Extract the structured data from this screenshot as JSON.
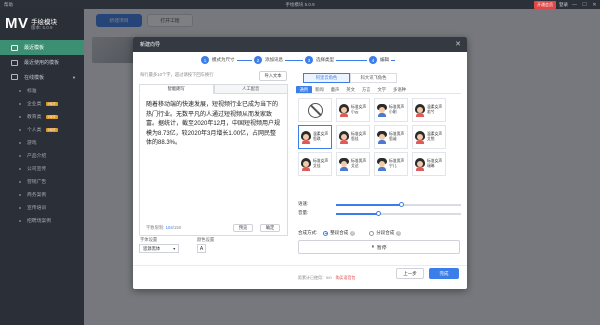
{
  "titlebar": {
    "help": "帮助",
    "title": "手绘模块 5.0.9",
    "vip": "开通会员",
    "login": "登录",
    "minimize": "—",
    "maximize": "☐",
    "close": "✕"
  },
  "brand": {
    "logo": "MV",
    "name": "手绘模块",
    "version": "版本: 5.0.9"
  },
  "sidebar": {
    "recent": "最近模板",
    "recent_used": "最近使用的模板",
    "online": "在线模板",
    "items": [
      {
        "label": "标准",
        "hot": ""
      },
      {
        "label": "企业类",
        "hot": "HOT"
      },
      {
        "label": "教育类",
        "hot": "HOT"
      },
      {
        "label": "个人类",
        "hot": "HOT"
      },
      {
        "label": "游戏",
        "hot": ""
      },
      {
        "label": "产品介绍",
        "hot": ""
      },
      {
        "label": "公司宣传",
        "hot": ""
      },
      {
        "label": "营销广告",
        "hot": ""
      },
      {
        "label": "商务案例",
        "hot": ""
      },
      {
        "label": "宣传培训",
        "hot": ""
      },
      {
        "label": "招聘场案例",
        "hot": ""
      }
    ]
  },
  "toolbar": {
    "new_project": "新建项目",
    "open_project": "打开工程"
  },
  "dialog": {
    "title": "新建向导",
    "close": "✕",
    "steps": [
      {
        "num": "1",
        "label": "模式为尺寸"
      },
      {
        "num": "2",
        "label": "添加讯息"
      },
      {
        "num": "3",
        "label": "选择类型"
      },
      {
        "num": "4",
        "label": "编辑"
      }
    ],
    "hint": "每行最多10个字，超过请按下回车换行",
    "import": "导入文本",
    "tabs": [
      "智能朗写",
      "人工配音"
    ],
    "text": "随着移动端的快速发展，短视频行业已成为当下的热门行业。无数平凡的人通过短视频从而发家致富。据统计，截至2020年12月，中国短视频用户规模为8.73亿，较2020年3月增长1.00亿，占网民整体的88.3%。",
    "count_label": "字数限制:",
    "count_current": "104",
    "count_max": "/150",
    "preview": "预览",
    "confirm": "确定",
    "font_label": "字体设置",
    "color_label": "颜色设置",
    "font_value": "思源黑体",
    "color_value": "A",
    "voice_tabs": [
      "阿里云角色",
      "科大讯飞角色"
    ],
    "categories": [
      "通用",
      "新闻",
      "童声",
      "英文",
      "方言",
      "文学",
      "多语种"
    ],
    "voices": [
      {
        "t1": "",
        "t2": "",
        "type": "none"
      },
      {
        "t1": "标准女声",
        "t2": "小云",
        "type": "f"
      },
      {
        "t1": "标准男声",
        "t2": "小刚",
        "type": "m"
      },
      {
        "t1": "温柔女声",
        "t2": "若兮",
        "type": "f"
      },
      {
        "t1": "温柔女声",
        "t2": "思琪",
        "type": "f"
      },
      {
        "t1": "标准女声",
        "t2": "思佳",
        "type": "f"
      },
      {
        "t1": "标准男声",
        "t2": "思诚",
        "type": "m"
      },
      {
        "t1": "温柔女声",
        "t2": "艾悦",
        "type": "f"
      },
      {
        "t1": "标准女声",
        "t2": "艾佳",
        "type": "f"
      },
      {
        "t1": "标准男声",
        "t2": "艾达",
        "type": "m"
      },
      {
        "t1": "标准男声",
        "t2": "宁儿",
        "type": "m"
      },
      {
        "t1": "标准女声",
        "t2": "瑞琳",
        "type": "f"
      }
    ],
    "speed_label": "语速:",
    "volume_label": "音量:",
    "speed_level": 0.52,
    "volume_level": 0.34,
    "mode_label": "合成方式:",
    "mode_whole": "整段合成",
    "mode_segment": "分段合成",
    "pause": "暂停",
    "pause_icon": "⏸",
    "remaining": "距累计已使用：0/0",
    "buy": "购买语音包",
    "prev": "上一步",
    "done": "完成"
  },
  "colors": {
    "accent": "#3b7de9",
    "sidebar": "#2b2f37",
    "active": "#3d8f73",
    "vip": "#e04747"
  }
}
